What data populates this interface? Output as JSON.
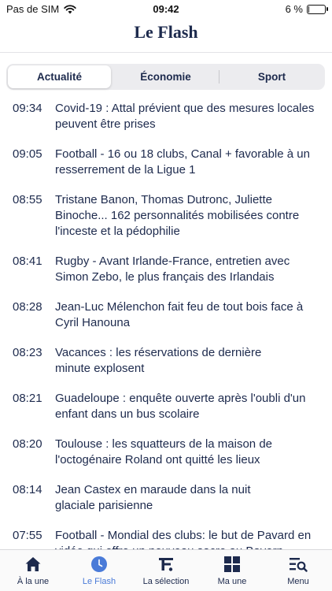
{
  "status_bar": {
    "carrier": "Pas de SIM",
    "time": "09:42",
    "battery": "6 %",
    "battery_level": 0.06
  },
  "header": {
    "title": "Le Flash"
  },
  "segments": [
    {
      "label": "Actualité",
      "active": true
    },
    {
      "label": "Économie",
      "active": false
    },
    {
      "label": "Sport",
      "active": false
    }
  ],
  "feed": [
    {
      "time": "09:34",
      "text": "Covid-19 : Attal prévient que des mesures locales peuvent être prises"
    },
    {
      "time": "09:05",
      "text": "Football - 16 ou 18 clubs, Canal + favorable à un resserrement de la Ligue 1"
    },
    {
      "time": "08:55",
      "text": "Tristane Banon, Thomas Dutronc, Juliette Binoche... 162 personnalités mobilisées contre l'inceste et la pédophilie"
    },
    {
      "time": "08:41",
      "text": "Rugby - Avant Irlande-France, entretien avec Simon Zebo, le plus français des Irlandais"
    },
    {
      "time": "08:28",
      "text": "Jean-Luc Mélenchon fait feu de tout bois face à Cyril Hanouna"
    },
    {
      "time": "08:23",
      "text": "Vacances : les réservations de dernière minute explosent"
    },
    {
      "time": "08:21",
      "text": "Guadeloupe : enquête ouverte après l'oubli d'un enfant dans un bus scolaire"
    },
    {
      "time": "08:20",
      "text": "Toulouse : les squatteurs de la maison de l'octogénaire Roland ont quitté les lieux"
    },
    {
      "time": "08:14",
      "text": "Jean Castex en maraude dans la nuit glaciale parisienne"
    },
    {
      "time": "07:55",
      "text": "Football - Mondial des clubs: le but de Pavard en vidéo qui offre un nouveau sacre au Bayern"
    }
  ],
  "tabbar": [
    {
      "label": "À la une",
      "icon": "home-icon",
      "active": false
    },
    {
      "label": "Le Flash",
      "icon": "clock-icon",
      "active": true
    },
    {
      "label": "La sélection",
      "icon": "selection-logo-icon",
      "active": false
    },
    {
      "label": "Ma une",
      "icon": "grid-icon",
      "active": false
    },
    {
      "label": "Menu",
      "icon": "menu-search-icon",
      "active": false
    }
  ],
  "colors": {
    "text": "#1d2a4d",
    "accent": "#4a7bd8",
    "segment_bg": "#ececef"
  }
}
